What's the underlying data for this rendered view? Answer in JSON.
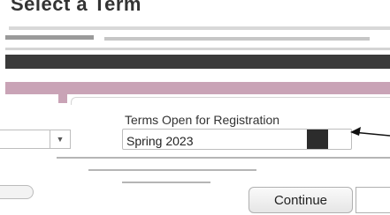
{
  "page": {
    "title": "Select a Term"
  },
  "term_form": {
    "label": "Terms Open for Registration",
    "selected_term": "Spring 2023",
    "continue_label": "Continue"
  },
  "colors": {
    "pink_band": "#c9a3b6",
    "dark_band": "#3a3a3a"
  }
}
